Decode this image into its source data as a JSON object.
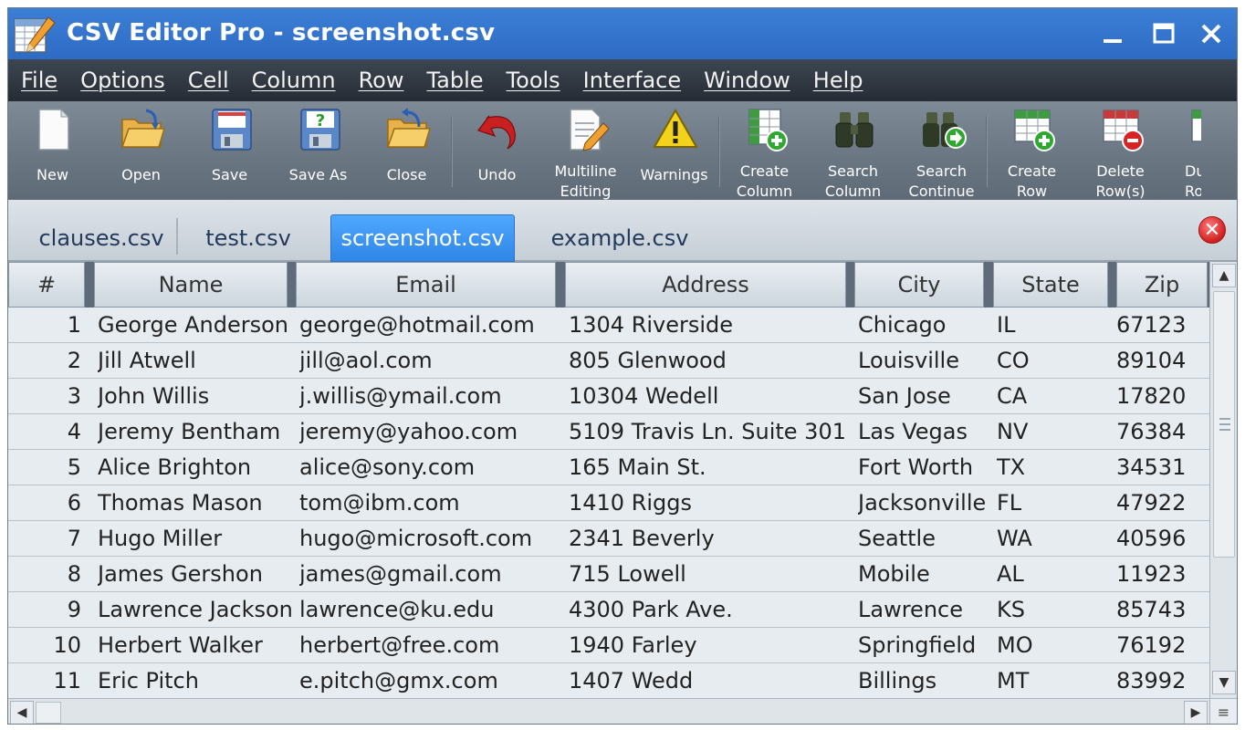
{
  "window": {
    "title": "CSV Editor Pro - screenshot.csv",
    "controls": {
      "minimize": "▁",
      "maximize": "☐",
      "close": "✕"
    }
  },
  "menu": [
    "File",
    "Options",
    "Cell",
    "Column",
    "Row",
    "Table",
    "Tools",
    "Interface",
    "Window",
    "Help"
  ],
  "toolbar": {
    "new": "New",
    "open": "Open",
    "save": "Save",
    "save_as": "Save As",
    "close": "Close",
    "undo": "Undo",
    "multiline_1": "Multiline",
    "multiline_2": "Editing",
    "warnings": "Warnings",
    "create_column_1": "Create",
    "create_column_2": "Column",
    "search_column_1": "Search",
    "search_column_2": "Column",
    "search_continue_1": "Search",
    "search_continue_2": "Continue",
    "create_row_1": "Create",
    "create_row_2": "Row",
    "delete_rows_1": "Delete",
    "delete_rows_2": "Row(s)",
    "duplicate_1": "Dupl",
    "duplicate_2": "Ro"
  },
  "tabs": [
    {
      "label": "clauses.csv",
      "active": false
    },
    {
      "label": "test.csv",
      "active": false
    },
    {
      "label": "screenshot.csv",
      "active": true
    },
    {
      "label": "example.csv",
      "active": false
    }
  ],
  "tab_close": "✕",
  "table": {
    "columns": [
      "#",
      "Name",
      "Email",
      "Address",
      "City",
      "State",
      "Zip"
    ],
    "rows": [
      [
        "1",
        "George Anderson",
        "george@hotmail.com",
        "1304 Riverside",
        "Chicago",
        "IL",
        "67123"
      ],
      [
        "2",
        "Jill Atwell",
        "jill@aol.com",
        "805 Glenwood",
        "Louisville",
        "CO",
        "89104"
      ],
      [
        "3",
        "John Willis",
        "j.willis@ymail.com",
        "10304 Wedell",
        "San Jose",
        "CA",
        "17820"
      ],
      [
        "4",
        "Jeremy Bentham",
        "jeremy@yahoo.com",
        "5109 Travis Ln. Suite 301",
        "Las Vegas",
        "NV",
        "76384"
      ],
      [
        "5",
        "Alice Brighton",
        "alice@sony.com",
        "165 Main St.",
        "Fort Worth",
        "TX",
        "34531"
      ],
      [
        "6",
        "Thomas Mason",
        "tom@ibm.com",
        "1410 Riggs",
        "Jacksonville",
        "FL",
        "47922"
      ],
      [
        "7",
        "Hugo Miller",
        "hugo@microsoft.com",
        "2341 Beverly",
        "Seattle",
        "WA",
        "40596"
      ],
      [
        "8",
        "James Gershon",
        "james@gmail.com",
        "715 Lowell",
        "Mobile",
        "AL",
        "11923"
      ],
      [
        "9",
        "Lawrence Jackson",
        "lawrence@ku.edu",
        "4300 Park Ave.",
        "Lawrence",
        "KS",
        "85743"
      ],
      [
        "10",
        "Herbert Walker",
        "herbert@free.com",
        "1940 Farley",
        "Springfield",
        "MO",
        "76192"
      ],
      [
        "11",
        "Eric Pitch",
        "e.pitch@gmx.com",
        "1407 Wedd",
        "Billings",
        "MT",
        "83992"
      ]
    ]
  },
  "scroll": {
    "up": "▲",
    "down": "▼",
    "left": "◀",
    "right": "▶",
    "corner": "≡"
  },
  "colors": {
    "titlebar": "#3c7fd6",
    "menubar": "#2d343d",
    "toolbar": "#6f7a87",
    "active_tab": "#3a93f0"
  }
}
